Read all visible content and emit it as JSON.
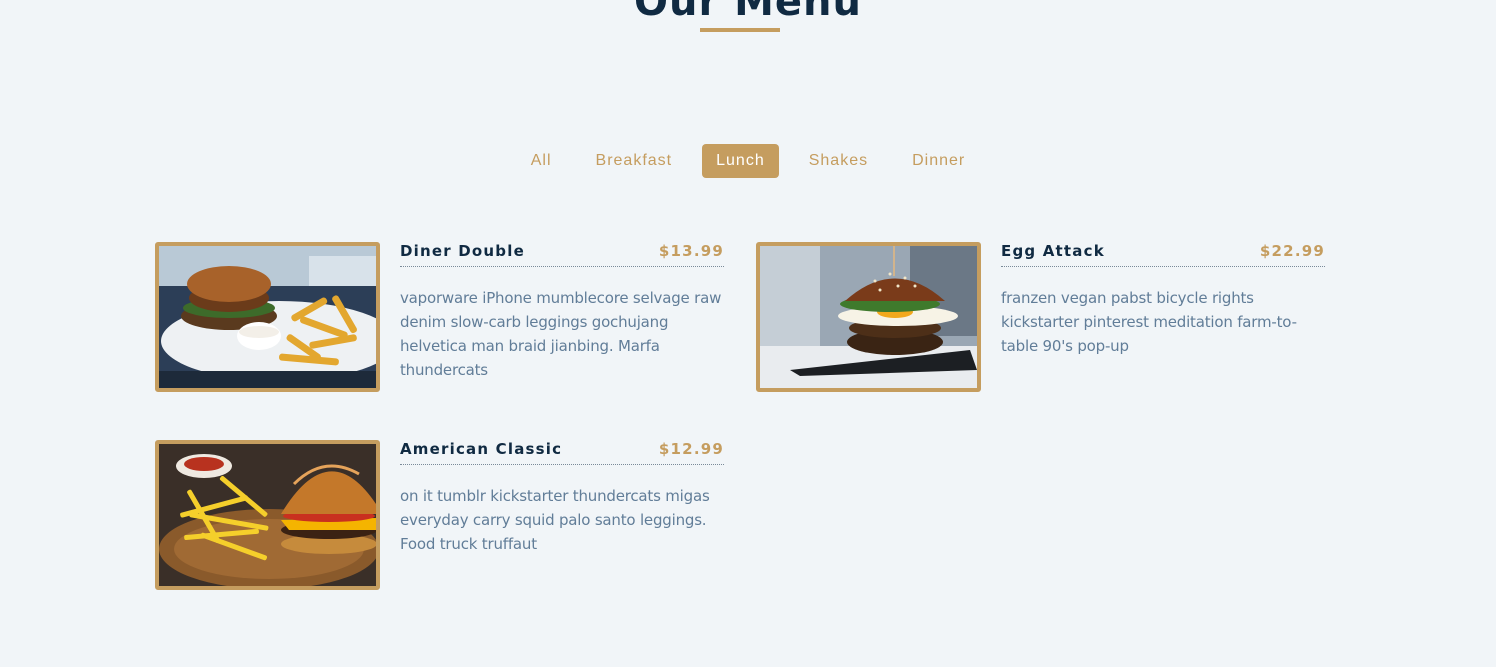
{
  "section": {
    "title": "Our Menu"
  },
  "filters": [
    {
      "label": "All",
      "active": false
    },
    {
      "label": "Breakfast",
      "active": false
    },
    {
      "label": "Lunch",
      "active": true
    },
    {
      "label": "Shakes",
      "active": false
    },
    {
      "label": "Dinner",
      "active": false
    }
  ],
  "menu": {
    "items": [
      {
        "name": "Diner Double",
        "price": "$13.99",
        "desc": "vaporware iPhone mumblecore selvage raw denim slow-carb leggings gochujang helvetica man braid jianbing. Marfa thundercats",
        "image": "burger-with-fries-photo"
      },
      {
        "name": "Egg Attack",
        "price": "$22.99",
        "desc": "franzen vegan pabst bicycle rights kickstarter pinterest meditation farm-to-table 90's pop-up",
        "image": "egg-burger-photo"
      },
      {
        "name": "American Classic",
        "price": "$12.99",
        "desc": "on it tumblr kickstarter thundercats migas everyday carry squid palo santo leggings. Food truck truffaut",
        "image": "cheeseburger-fries-photo"
      }
    ]
  },
  "colors": {
    "background": "#f1f5f8",
    "accent": "#c59d5f",
    "heading": "#102a42",
    "text": "#617d98"
  }
}
